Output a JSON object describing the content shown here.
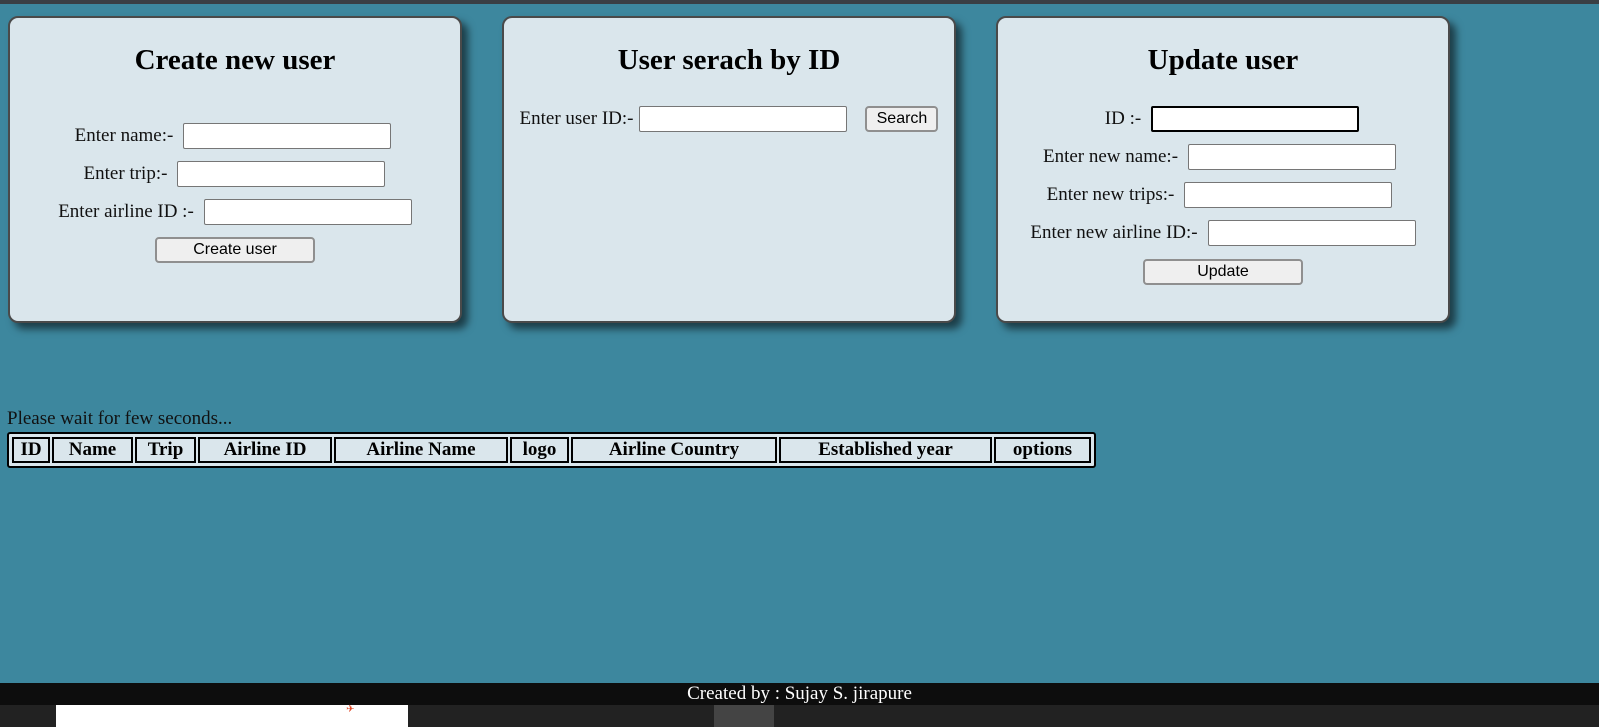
{
  "create_card": {
    "title": "Create new user",
    "name_label": "Enter name:-",
    "trip_label": "Enter trip:-",
    "airline_label": "Enter airline ID :-",
    "name_value": "",
    "trip_value": "",
    "airline_value": "",
    "button_label": "Create user"
  },
  "search_card": {
    "title": "User serach by ID",
    "id_label": "Enter user ID:-",
    "id_value": "",
    "button_label": "Search"
  },
  "update_card": {
    "title": "Update user",
    "id_label": "ID :-",
    "name_label": "Enter new name:-",
    "trips_label": "Enter new trips:-",
    "airline_label": "Enter new airline ID:-",
    "id_value": "",
    "name_value": "",
    "trips_value": "",
    "airline_value": "",
    "button_label": "Update"
  },
  "status_text": "Please wait for few seconds...",
  "table": {
    "headers": [
      "ID",
      "Name",
      "Trip",
      "Airline ID",
      "Airline Name",
      "logo",
      "Airline Country",
      "Established year",
      "options"
    ]
  },
  "footer": {
    "text": "Created by : Sujay S. jirapure"
  },
  "colors": {
    "background": "#3d879e",
    "card": "#dae6ec",
    "footer": "#0d0d0d"
  }
}
